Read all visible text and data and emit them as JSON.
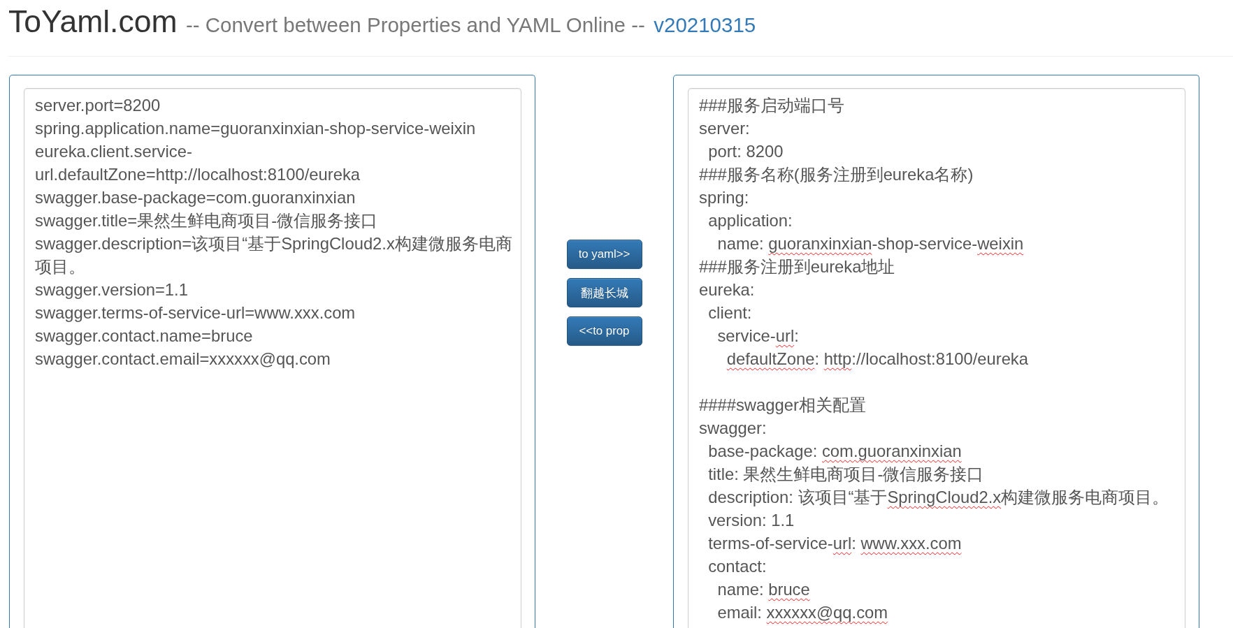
{
  "header": {
    "title": "ToYaml.com",
    "tagline": "-- Convert between Properties and YAML Online --",
    "version": "v20210315"
  },
  "properties": {
    "lines": [
      "server.port=8200",
      "spring.application.name=guoranxinxian-shop-service-weixin",
      "eureka.client.service-url.defaultZone=http://localhost:8100/eureka",
      "swagger.base-package=com.guoranxinxian",
      "swagger.title=果然生鲜电商项目-微信服务接口",
      "swagger.description=该项目“基于SpringCloud2.x构建微服务电商项目。",
      "swagger.version=1.1",
      "swagger.terms-of-service-url=www.xxx.com",
      "swagger.contact.name=bruce",
      "swagger.contact.email=xxxxxx@qq.com"
    ]
  },
  "buttons": [
    {
      "label": "to yaml>>"
    },
    {
      "label": "翻越长城"
    },
    {
      "label": "<<to prop"
    }
  ],
  "yaml": {
    "blocks": [
      {
        "lines": [
          {
            "parts": [
              {
                "text": "###服务启动端口号",
                "flagged": false
              }
            ]
          },
          {
            "parts": [
              {
                "text": "server:",
                "flagged": false
              }
            ],
            "children": [
              {
                "parts": [
                  {
                    "text": "port: 8200",
                    "flagged": false
                  }
                ]
              }
            ]
          },
          {
            "parts": [
              {
                "text": "###服务名称(服务注册到eureka名称)",
                "flagged": false
              }
            ]
          },
          {
            "parts": [
              {
                "text": "spring:",
                "flagged": false
              }
            ],
            "children": [
              {
                "parts": [
                  {
                    "text": "application:",
                    "flagged": false
                  }
                ],
                "children": [
                  {
                    "parts": [
                      {
                        "text": "name: ",
                        "flagged": false
                      },
                      {
                        "text": "guoranxinxian",
                        "flagged": true
                      },
                      {
                        "text": "-shop-service-",
                        "flagged": false
                      },
                      {
                        "text": "weixin",
                        "flagged": true
                      }
                    ]
                  }
                ]
              }
            ]
          },
          {
            "parts": [
              {
                "text": "###服务注册到eureka地址",
                "flagged": false
              }
            ]
          },
          {
            "parts": [
              {
                "text": "eureka:",
                "flagged": false
              }
            ],
            "children": [
              {
                "parts": [
                  {
                    "text": "client:",
                    "flagged": false
                  }
                ],
                "children": [
                  {
                    "parts": [
                      {
                        "text": "service-",
                        "flagged": false
                      },
                      {
                        "text": "url",
                        "flagged": true
                      },
                      {
                        "text": ":",
                        "flagged": false
                      }
                    ],
                    "children": [
                      {
                        "parts": [
                          {
                            "text": "defaultZone",
                            "flagged": true
                          },
                          {
                            "text": ": ",
                            "flagged": false
                          },
                          {
                            "text": "http",
                            "flagged": true
                          },
                          {
                            "text": "://localhost:8100/eureka",
                            "flagged": false
                          }
                        ]
                      }
                    ]
                  }
                ]
              }
            ]
          }
        ]
      },
      {
        "lines": [
          {
            "parts": [
              {
                "text": "####swagger相关配置",
                "flagged": false
              }
            ]
          },
          {
            "parts": [
              {
                "text": "swagger:",
                "flagged": false
              }
            ],
            "children": [
              {
                "parts": [
                  {
                    "text": "base-package: ",
                    "flagged": false
                  },
                  {
                    "text": "com.guoranxinxian",
                    "flagged": true
                  }
                ]
              },
              {
                "parts": [
                  {
                    "text": "title: 果然生鲜电商项目-微信服务接口",
                    "flagged": false
                  }
                ]
              },
              {
                "parts": [
                  {
                    "text": "description: 该项目“基于",
                    "flagged": false
                  },
                  {
                    "text": "SpringCloud2.x",
                    "flagged": true
                  },
                  {
                    "text": "构建微服务电商项目。",
                    "flagged": false
                  }
                ]
              },
              {
                "parts": [
                  {
                    "text": "version: 1.1",
                    "flagged": false
                  }
                ]
              },
              {
                "parts": [
                  {
                    "text": "terms-of-service-",
                    "flagged": false
                  },
                  {
                    "text": "url",
                    "flagged": true
                  },
                  {
                    "text": ": ",
                    "flagged": false
                  },
                  {
                    "text": "www.xxx.com",
                    "flagged": true
                  }
                ]
              },
              {
                "parts": [
                  {
                    "text": "contact:",
                    "flagged": false
                  }
                ],
                "children": [
                  {
                    "parts": [
                      {
                        "text": "name: ",
                        "flagged": false
                      },
                      {
                        "text": "bruce",
                        "flagged": true
                      }
                    ]
                  },
                  {
                    "parts": [
                      {
                        "text": "email: ",
                        "flagged": false
                      },
                      {
                        "text": "xxxxxx@qq.com",
                        "flagged": true
                      }
                    ]
                  }
                ]
              }
            ]
          }
        ]
      }
    ]
  }
}
